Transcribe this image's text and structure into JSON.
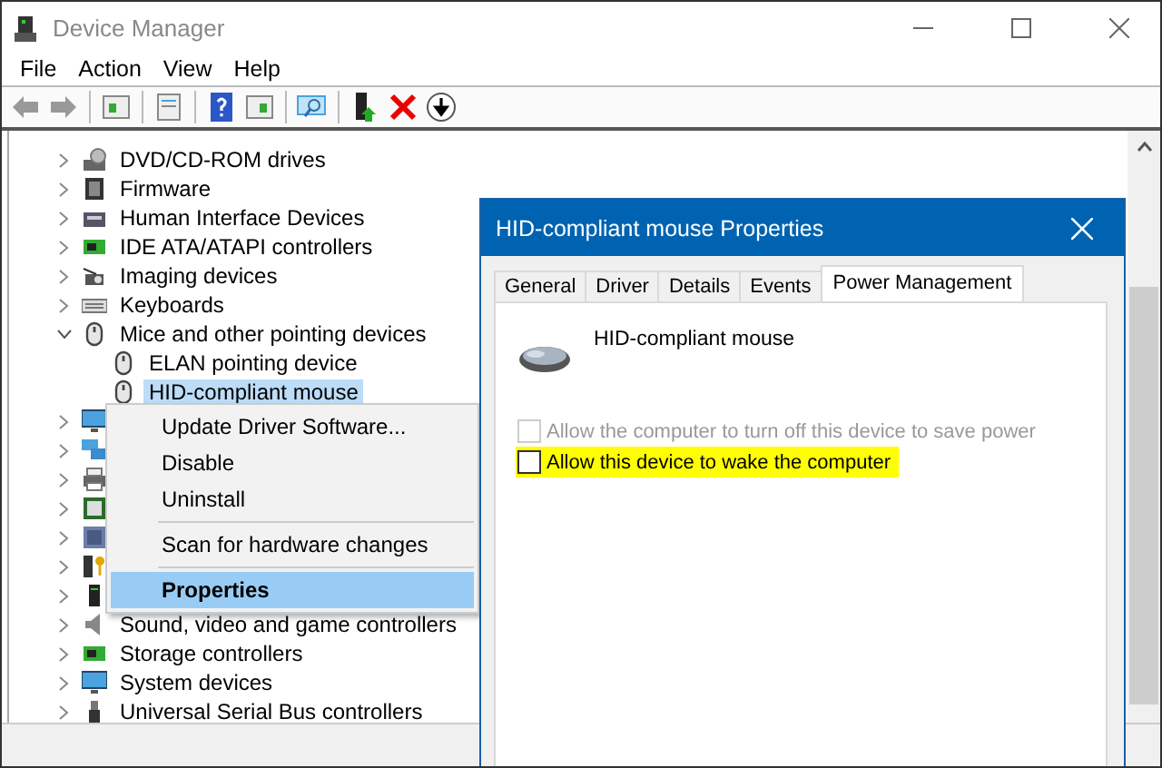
{
  "window": {
    "title": "Device Manager"
  },
  "menu": [
    "File",
    "Action",
    "View",
    "Help"
  ],
  "tree": [
    {
      "label": "DVD/CD-ROM drives",
      "kind": "disc",
      "expanded": false,
      "selected": false
    },
    {
      "label": "Firmware",
      "kind": "chip",
      "expanded": false,
      "selected": false
    },
    {
      "label": "Human Interface Devices",
      "kind": "hid",
      "expanded": false,
      "selected": false
    },
    {
      "label": "IDE ATA/ATAPI controllers",
      "kind": "card",
      "expanded": false,
      "selected": false
    },
    {
      "label": "Imaging devices",
      "kind": "camera",
      "expanded": false,
      "selected": false
    },
    {
      "label": "Keyboards",
      "kind": "keyboard",
      "expanded": false,
      "selected": false
    },
    {
      "label": "Mice and other pointing devices",
      "kind": "mouse",
      "expanded": true,
      "selected": false,
      "children": [
        {
          "label": "ELAN pointing device",
          "kind": "mouse",
          "selected": false
        },
        {
          "label": "HID-compliant mouse",
          "kind": "mouse",
          "selected": true
        }
      ]
    },
    {
      "kind": "monitor",
      "expanded": false
    },
    {
      "kind": "network",
      "expanded": false
    },
    {
      "kind": "printer",
      "expanded": false
    },
    {
      "kind": "processor",
      "expanded": false
    },
    {
      "kind": "processor2",
      "expanded": false
    },
    {
      "kind": "security",
      "expanded": false
    },
    {
      "kind": "tower",
      "expanded": false
    },
    {
      "label": "Sound, video and game controllers",
      "kind": "sound",
      "expanded": false,
      "selected": false
    },
    {
      "label": "Storage controllers",
      "kind": "card",
      "expanded": false,
      "selected": false
    },
    {
      "label": "System devices",
      "kind": "monitor",
      "expanded": false,
      "selected": false
    },
    {
      "label": "Universal Serial Bus controllers",
      "kind": "usb",
      "expanded": false,
      "selected": false
    }
  ],
  "context_menu": [
    {
      "label": "Update Driver Software...",
      "kind": "item",
      "selected": false,
      "bold": false
    },
    {
      "label": "Disable",
      "kind": "item",
      "selected": false,
      "bold": false
    },
    {
      "label": "Uninstall",
      "kind": "item",
      "selected": false,
      "bold": false
    },
    {
      "kind": "separator"
    },
    {
      "label": "Scan for hardware changes",
      "kind": "item",
      "selected": false,
      "bold": false
    },
    {
      "kind": "separator"
    },
    {
      "label": "Properties",
      "kind": "item",
      "selected": true,
      "bold": true
    }
  ],
  "dialog": {
    "title": "HID-compliant mouse Properties",
    "tabs": [
      {
        "label": "General",
        "selected": false
      },
      {
        "label": "Driver",
        "selected": false
      },
      {
        "label": "Details",
        "selected": false
      },
      {
        "label": "Events",
        "selected": false
      },
      {
        "label": "Power Management",
        "selected": true
      }
    ],
    "device_name": "HID-compliant mouse",
    "options": [
      {
        "label": "Allow the computer to turn off this device to save power",
        "checked": false,
        "disabled": true,
        "highlighted": false
      },
      {
        "label": "Allow this device to wake the computer",
        "checked": false,
        "disabled": false,
        "highlighted": true
      }
    ]
  }
}
